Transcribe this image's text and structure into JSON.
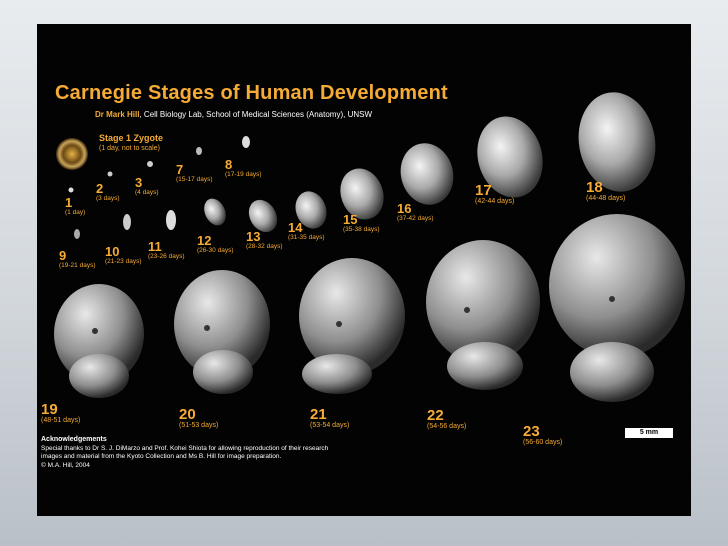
{
  "header": {
    "title": "Carnegie Stages of Human Development",
    "subtitle_author": "Dr Mark Hill",
    "subtitle_rest": ", Cell Biology Lab, School of Medical Sciences (Anatomy), UNSW"
  },
  "zygote": {
    "label": "Stage 1 Zygote",
    "note": "(1 day, not to scale)"
  },
  "stages": [
    {
      "num": "1",
      "days": "(1 day)"
    },
    {
      "num": "2",
      "days": "(3 days)"
    },
    {
      "num": "3",
      "days": "(4 days)"
    },
    {
      "num": "7",
      "days": "(15-17 days)"
    },
    {
      "num": "8",
      "days": "(17-19 days)"
    },
    {
      "num": "9",
      "days": "(19-21 days)"
    },
    {
      "num": "10",
      "days": "(21-23 days)"
    },
    {
      "num": "11",
      "days": "(23-26 days)"
    },
    {
      "num": "12",
      "days": "(26-30 days)"
    },
    {
      "num": "13",
      "days": "(28-32 days)"
    },
    {
      "num": "14",
      "days": "(31-35 days)"
    },
    {
      "num": "15",
      "days": "(35-38 days)"
    },
    {
      "num": "16",
      "days": "(37-42 days)"
    },
    {
      "num": "17",
      "days": "(42-44 days)"
    },
    {
      "num": "18",
      "days": "(44-48 days)"
    },
    {
      "num": "19",
      "days": "(48-51 days)"
    },
    {
      "num": "20",
      "days": "(51-53 days)"
    },
    {
      "num": "21",
      "days": "(53-54 days)"
    },
    {
      "num": "22",
      "days": "(54-56 days)"
    },
    {
      "num": "23",
      "days": "(56-60 days)"
    }
  ],
  "acknowledgements": {
    "title": "Acknowledgements",
    "line1": "Special thanks to Dr S. J. DiMarzo and Prof. Kohei Shiota for allowing reproduction of their research",
    "line2": "images and material from the Kyoto Collection and Ms B. Hill for image preparation.",
    "line3": "© M.A. Hill, 2004"
  },
  "scale_bar": "5 mm",
  "colors": {
    "background": "#030303",
    "accent": "#f5ab35",
    "text": "#ffffff"
  }
}
